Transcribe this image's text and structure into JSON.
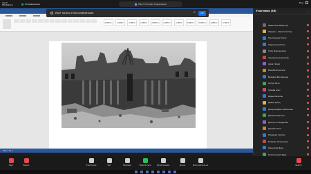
{
  "app": {
    "name": "zoom Workplace"
  },
  "topbar": {
    "conference_label": "Конференция",
    "share_text": "Идет Огорова Нидемовна",
    "view_label": "Вид"
  },
  "popup": {
    "message": "Идет запись этой конференции",
    "ok_label": "OK"
  },
  "ribbon": {
    "styles": [
      "AaBbCc",
      "AaBbC",
      "AaBbC",
      "AaBbC",
      "AaBbCc",
      "AaBbCc",
      "AaBbC",
      "AaBbCc",
      "AaBbCc",
      "AaBbCc",
      "AaBbC"
    ]
  },
  "panel": {
    "title": "Участники (36)",
    "participants": [
      {
        "name": "Шамсиков Жамр (Я)",
        "color": "#6c6c6c"
      },
      {
        "name": "Федора... (Организатор)",
        "color": "#e0b341"
      },
      {
        "name": "Пантелеева Олеся",
        "color": "#2e7bd6"
      },
      {
        "name": "Лавренова Олеся",
        "color": "#2e7bd6"
      },
      {
        "name": "Гайд (Коршикова)",
        "color": "#888"
      },
      {
        "name": "Чекитиков Анатолий",
        "color": "#c44"
      },
      {
        "name": "Арма Галим",
        "color": "#8a5cd6"
      },
      {
        "name": "Белоболи Ангели",
        "color": "#e07a2f"
      },
      {
        "name": "Валерия Вяснянська",
        "color": "#2e7bd6"
      },
      {
        "name": "Артем Лечл",
        "color": "#3aa655"
      },
      {
        "name": "Гринёв Алис",
        "color": "#d6476b"
      },
      {
        "name": "Дарья Калвэль",
        "color": "#2e7bd6"
      },
      {
        "name": "Давид Кращ",
        "color": "#e0b341"
      },
      {
        "name": "Джеральдина Хайсанова",
        "color": "#2e7bd6"
      },
      {
        "name": "Дюкрап Бригола",
        "color": "#3aa655"
      },
      {
        "name": "Диктор Склюдарова",
        "color": "#8a5cd6"
      },
      {
        "name": "Джеймс Мост",
        "color": "#e07a2f"
      },
      {
        "name": "Ровирава Смилин",
        "color": "#2e7bd6"
      },
      {
        "name": "Болдарь Олександр",
        "color": "#c44"
      },
      {
        "name": "Кашинова Дарь",
        "color": "#2e7bd6"
      },
      {
        "name": "Колесницкий Дарь",
        "color": "#3aa655"
      },
      {
        "name": "Кольчинадор Дарья",
        "color": "#e0b341"
      }
    ],
    "invite_label": "Пригласить",
    "mute_all_label": "Выключить звук у всех"
  },
  "toolbar": {
    "items": [
      {
        "label": "Звук",
        "kind": "red"
      },
      {
        "label": "Видео",
        "kind": "red"
      },
      {
        "label": "Участники",
        "kind": "normal"
      },
      {
        "label": "Чат",
        "kind": "normal"
      },
      {
        "label": "Реакции",
        "kind": "normal"
      },
      {
        "label": "Поделиться",
        "kind": "green"
      },
      {
        "label": "Приложения",
        "kind": "normal"
      },
      {
        "label": "Доска",
        "kind": "normal"
      },
      {
        "label": "Дополнительно",
        "kind": "normal"
      },
      {
        "label": "Выйти",
        "kind": "red"
      }
    ]
  },
  "word": {
    "status": "Стр. 1 из 1"
  }
}
